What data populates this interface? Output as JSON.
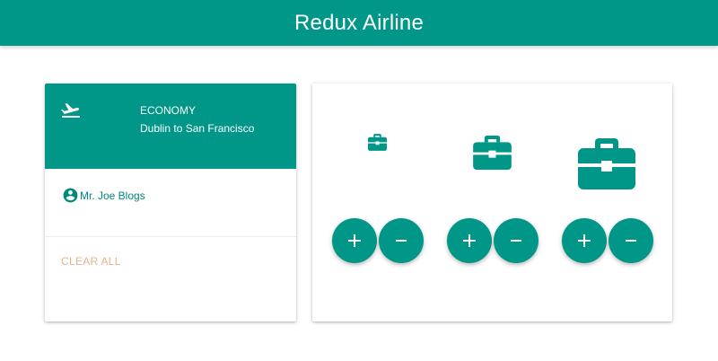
{
  "app_bar": {
    "title": "Redux Airline"
  },
  "flight": {
    "fare_class": "ECONOMY",
    "route": "Dublin to San Francisco",
    "icon": "flight-takeoff-icon"
  },
  "passenger": {
    "name": "Mr. Joe Blogs",
    "icon": "account-circle-icon"
  },
  "actions": {
    "clear_all": "CLEAR ALL"
  },
  "baggage": [
    {
      "size": "small",
      "icon": "briefcase-icon"
    },
    {
      "size": "medium",
      "icon": "briefcase-icon"
    },
    {
      "size": "large",
      "icon": "briefcase-icon"
    }
  ],
  "colors": {
    "primary": "#009688",
    "accent_text": "#00897b",
    "clear_all": "#e6b48a",
    "on_primary": "#ffffff"
  }
}
